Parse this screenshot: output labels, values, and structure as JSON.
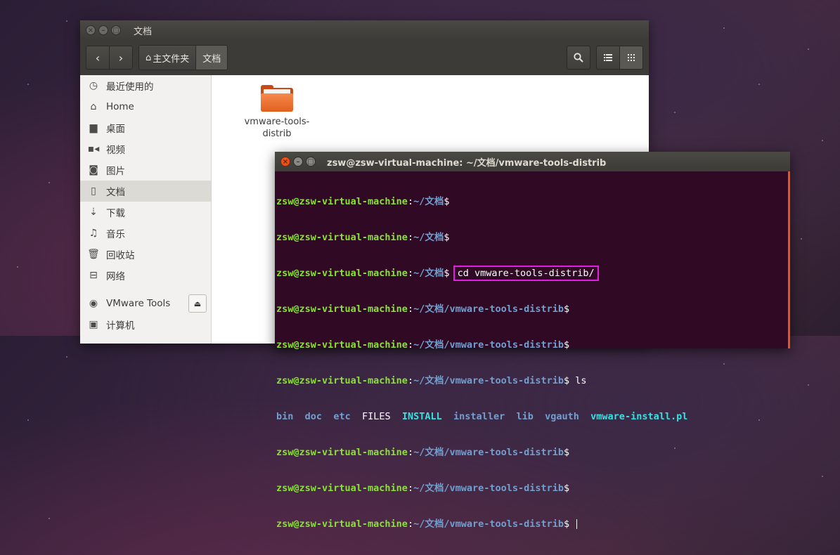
{
  "file_manager": {
    "title": "文档",
    "breadcrumbs": [
      {
        "label": "主文件夹",
        "icon": "home-icon"
      },
      {
        "label": "文档"
      }
    ],
    "sidebar": {
      "items": [
        {
          "label": "最近使用的",
          "icon": "clock-icon"
        },
        {
          "label": "Home",
          "icon": "home-icon"
        },
        {
          "label": "桌面",
          "icon": "folder-icon"
        },
        {
          "label": "视频",
          "icon": "video-icon"
        },
        {
          "label": "图片",
          "icon": "camera-icon"
        },
        {
          "label": "文档",
          "icon": "document-icon",
          "active": true
        },
        {
          "label": "下载",
          "icon": "download-icon"
        },
        {
          "label": "音乐",
          "icon": "music-icon"
        },
        {
          "label": "回收站",
          "icon": "trash-icon"
        },
        {
          "label": "网络",
          "icon": "network-icon"
        }
      ],
      "devices": [
        {
          "label": "VMware Tools",
          "icon": "disc-icon",
          "ejectable": true
        },
        {
          "label": "计算机",
          "icon": "computer-icon"
        }
      ]
    },
    "files": [
      {
        "name_line1": "vmware-tools-",
        "name_line2": "distrib",
        "type": "folder"
      }
    ]
  },
  "terminal": {
    "title": "zsw@zsw-virtual-machine: ~/文档/vmware-tools-distrib",
    "lines": [
      {
        "user": "zsw@zsw-virtual-machine",
        "path": "~/文档",
        "cmd": ""
      },
      {
        "user": "zsw@zsw-virtual-machine",
        "path": "~/文档",
        "cmd": ""
      },
      {
        "user": "zsw@zsw-virtual-machine",
        "path": "~/文档",
        "cmd": "cd vmware-tools-distrib/"
      },
      {
        "user": "zsw@zsw-virtual-machine",
        "path": "~/文档/vmware-tools-distrib",
        "cmd": ""
      },
      {
        "user": "zsw@zsw-virtual-machine",
        "path": "~/文档/vmware-tools-distrib",
        "cmd": ""
      },
      {
        "user": "zsw@zsw-virtual-machine",
        "path": "~/文档/vmware-tools-distrib",
        "cmd": "ls"
      }
    ],
    "ls_output": [
      "bin",
      "doc",
      "etc",
      "FILES",
      "INSTALL",
      "installer",
      "lib",
      "vgauth",
      "vmware-install.pl"
    ],
    "after_lines": [
      {
        "user": "zsw@zsw-virtual-machine",
        "path": "~/文档/vmware-tools-distrib",
        "cmd": ""
      },
      {
        "user": "zsw@zsw-virtual-machine",
        "path": "~/文档/vmware-tools-distrib",
        "cmd": ""
      },
      {
        "user": "zsw@zsw-virtual-machine",
        "path": "~/文档/vmware-tools-distrib",
        "cmd": ""
      }
    ],
    "colors": {
      "background": "#300a24",
      "user": "#8ae234",
      "path": "#729fcf",
      "highlight_box": "#e31ce3"
    }
  }
}
